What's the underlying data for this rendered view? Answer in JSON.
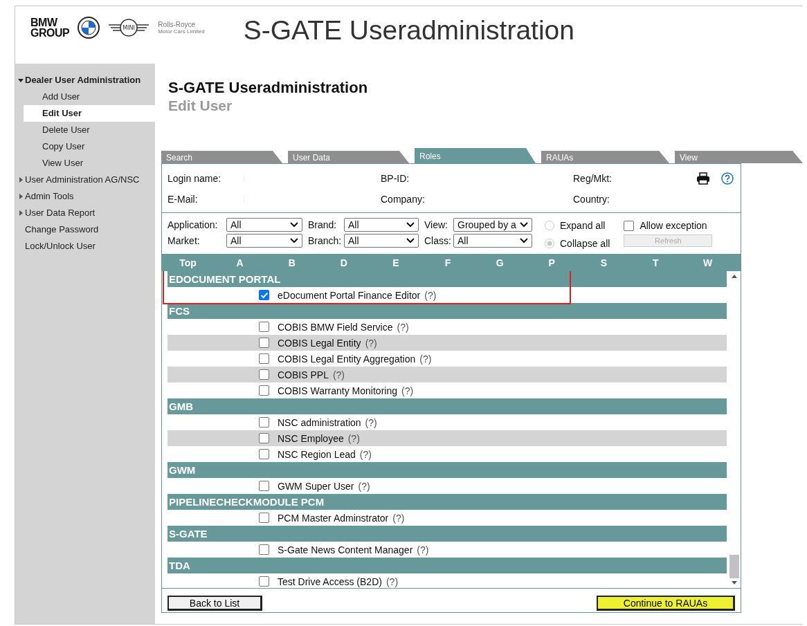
{
  "header": {
    "logo_text": [
      "BMW",
      "GROUP"
    ],
    "mini_text": "MINI",
    "rr_text": "Rolls-Royce",
    "rr_subtext": "Motor Cars Limited",
    "title": "S-GATE Useradministration"
  },
  "sidebar": {
    "items": [
      {
        "label": "Dealer User Administration",
        "expanded": true,
        "children": [
          {
            "label": "Add User",
            "selected": false
          },
          {
            "label": "Edit User",
            "selected": true
          },
          {
            "label": "Delete User",
            "selected": false
          },
          {
            "label": "Copy User",
            "selected": false
          },
          {
            "label": "View User",
            "selected": false
          }
        ]
      },
      {
        "label": "User Administration AG/NSC",
        "expanded": false
      },
      {
        "label": "Admin Tools",
        "expanded": false
      },
      {
        "label": "User Data Report",
        "expanded": false
      },
      {
        "label": "Change Password"
      },
      {
        "label": "Lock/Unlock User"
      }
    ]
  },
  "page": {
    "title": "S-GATE Useradministration",
    "subtitle": "Edit User"
  },
  "tabs": [
    {
      "label": "Search",
      "selected": false
    },
    {
      "label": "User Data",
      "selected": false
    },
    {
      "label": "Roles",
      "selected": true
    },
    {
      "label": "RAUAs",
      "selected": false
    },
    {
      "label": "View",
      "selected": false
    }
  ],
  "user_info": [
    {
      "label": "Login name:",
      "label2": "BP-ID:",
      "label3": "Reg/Mkt:"
    },
    {
      "label": "E-Mail:",
      "label2": "Company:",
      "label3": "Country:"
    }
  ],
  "filters": {
    "rows": [
      [
        {
          "label": "Application:",
          "value": "All"
        },
        {
          "label": "Brand:",
          "value": "All"
        },
        {
          "label": "View:",
          "value": "Grouped by a"
        }
      ],
      [
        {
          "label": "Market:",
          "value": "All"
        },
        {
          "label": "Branch:",
          "value": "All"
        },
        {
          "label": "Class:",
          "value": "All"
        }
      ]
    ],
    "radios": [
      {
        "label": "Expand all",
        "selected": false
      },
      {
        "label": "Collapse all",
        "selected": true
      }
    ],
    "allow_exception": {
      "label": "Allow exception",
      "checked": false
    },
    "refresh": {
      "label": "Refresh",
      "disabled": true
    }
  },
  "letters": [
    "Top",
    "A",
    "B",
    "D",
    "E",
    "F",
    "G",
    "P",
    "S",
    "T",
    "W"
  ],
  "groups": [
    {
      "name": "EDOCUMENT PORTAL",
      "roles": [
        {
          "label": "eDocument Portal Finance Editor",
          "help": "(?)",
          "checked": true
        }
      ]
    },
    {
      "name": "FCS",
      "roles": [
        {
          "label": "COBIS BMW Field Service",
          "help": "(?)",
          "checked": false
        },
        {
          "label": "COBIS Legal Entity",
          "help": "(?)",
          "checked": false
        },
        {
          "label": "COBIS Legal Entity Aggregation",
          "help": "(?)",
          "checked": false
        },
        {
          "label": "COBIS PPL",
          "help": "(?)",
          "checked": false
        },
        {
          "label": "COBIS Warranty Monitoring",
          "help": "(?)",
          "checked": false
        }
      ]
    },
    {
      "name": "GMB",
      "roles": [
        {
          "label": "NSC administration",
          "help": "(?)",
          "checked": false
        },
        {
          "label": "NSC Employee",
          "help": "(?)",
          "checked": false
        },
        {
          "label": "NSC Region Lead",
          "help": "(?)",
          "checked": false
        }
      ]
    },
    {
      "name": "GWM",
      "roles": [
        {
          "label": "GWM Super User",
          "help": "(?)",
          "checked": false
        }
      ]
    },
    {
      "name": "PIPELINECHECKMODULE PCM",
      "roles": [
        {
          "label": "PCM Master Adminstrator",
          "help": "(?)",
          "checked": false
        }
      ]
    },
    {
      "name": "S-GATE",
      "roles": [
        {
          "label": "S-Gate News Content Manager",
          "help": "(?)",
          "checked": false
        }
      ]
    },
    {
      "name": "TDA",
      "roles": [
        {
          "label": "Test Drive Access (B2D)",
          "help": "(?)",
          "checked": false
        }
      ]
    }
  ],
  "buttons": {
    "back": "Back to List",
    "continue": "Continue to RAUAs"
  }
}
